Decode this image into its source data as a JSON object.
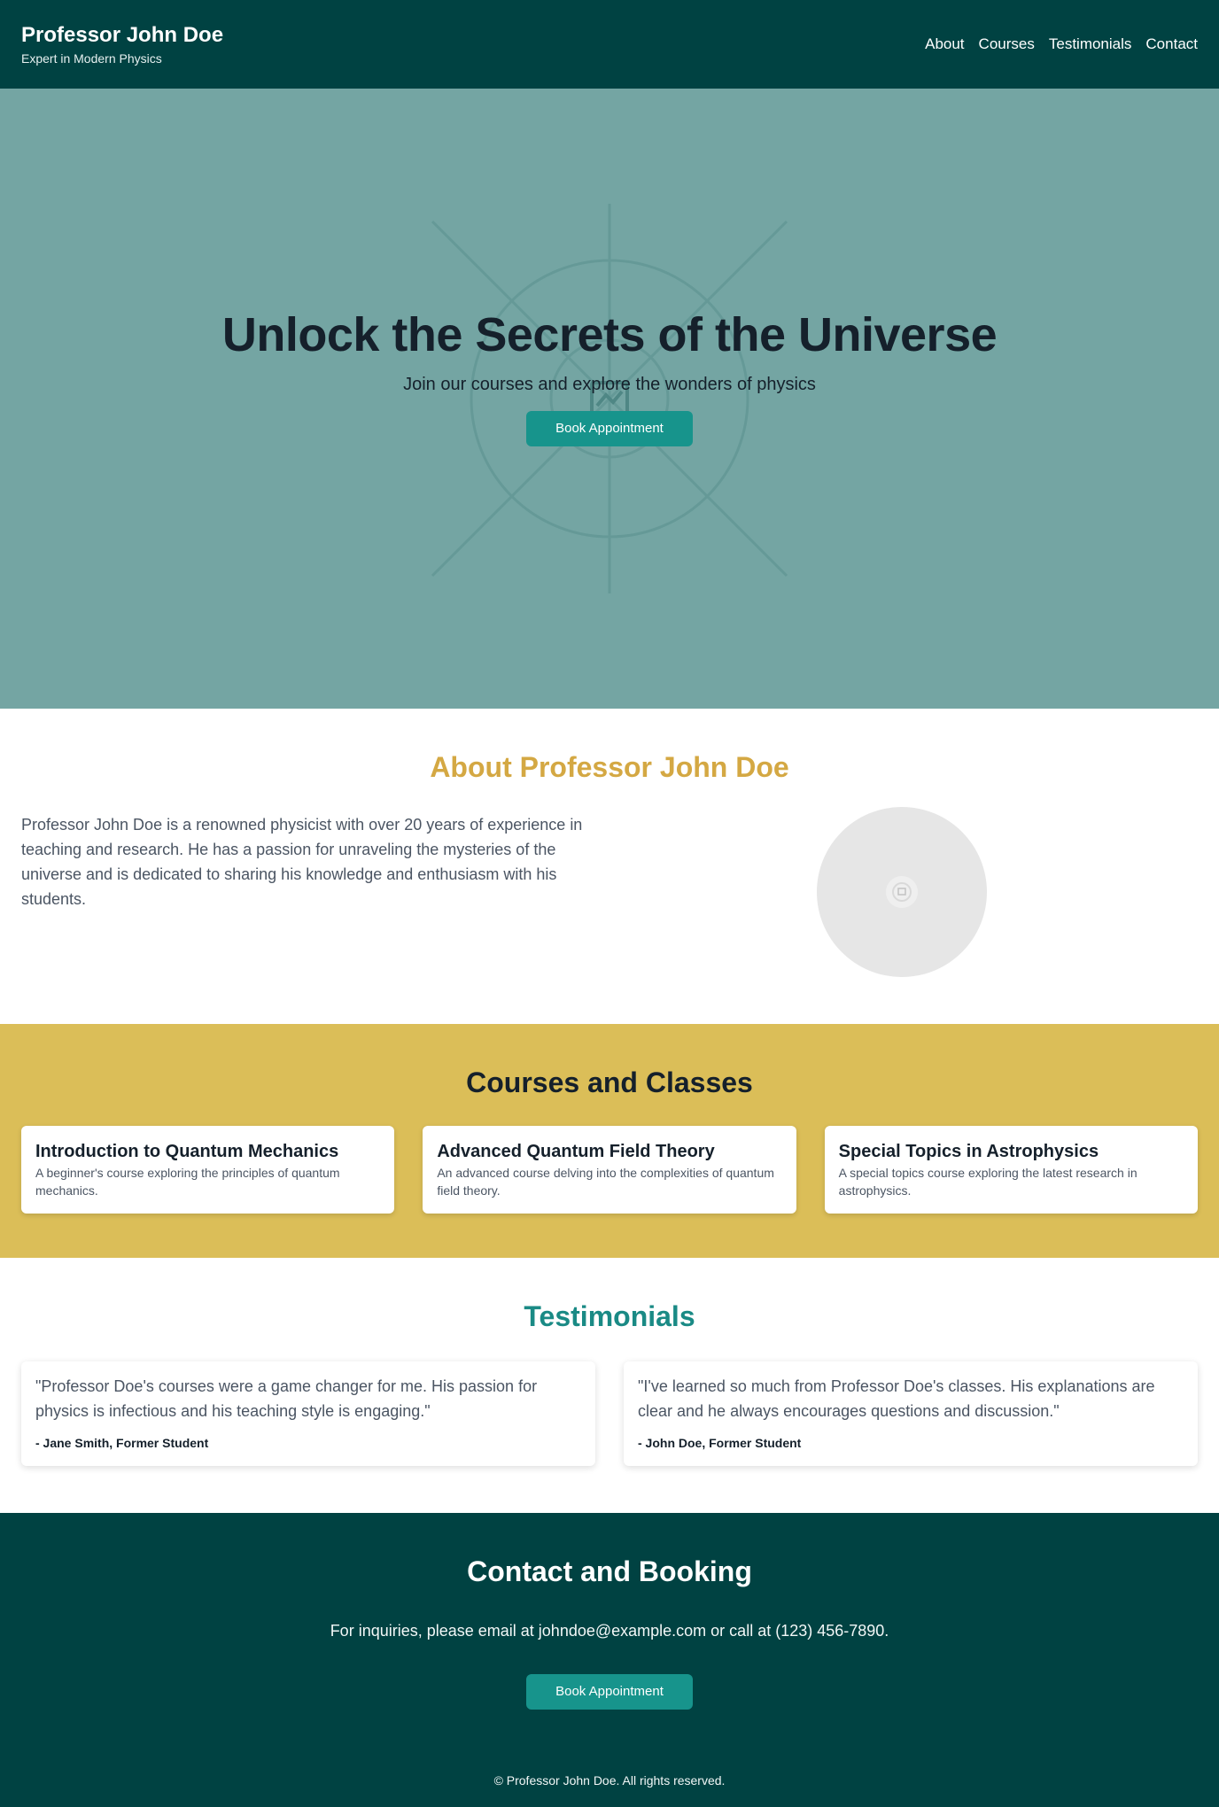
{
  "header": {
    "name": "Professor John Doe",
    "tagline": "Expert in Modern Physics",
    "nav": [
      "About",
      "Courses",
      "Testimonials",
      "Contact"
    ]
  },
  "hero": {
    "title": "Unlock the Secrets of the Universe",
    "subtitle": "Join our courses and explore the wonders of physics",
    "button": "Book Appointment",
    "background_icon": "image-placeholder-icon"
  },
  "about": {
    "title": "About Professor John Doe",
    "text": "Professor John Doe is a renowned physicist with over 20 years of experience in teaching and research. He has a passion for unraveling the mysteries of the universe and is dedicated to sharing his knowledge and enthusiasm with his students.",
    "photo_icon": "avatar-placeholder-icon"
  },
  "courses": {
    "title": "Courses and Classes",
    "items": [
      {
        "title": "Introduction to Quantum Mechanics",
        "description": "A beginner's course exploring the principles of quantum mechanics."
      },
      {
        "title": "Advanced Quantum Field Theory",
        "description": "An advanced course delving into the complexities of quantum field theory."
      },
      {
        "title": "Special Topics in Astrophysics",
        "description": "A special topics course exploring the latest research in astrophysics."
      }
    ]
  },
  "testimonials": {
    "title": "Testimonials",
    "items": [
      {
        "quote": "\"Professor Doe's courses were a game changer for me. His passion for physics is infectious and his teaching style is engaging.\"",
        "author": "- Jane Smith, Former Student"
      },
      {
        "quote": "\"I've learned so much from Professor Doe's classes. His explanations are clear and he always encourages questions and discussion.\"",
        "author": "- John Doe, Former Student"
      }
    ]
  },
  "contact": {
    "title": "Contact and Booking",
    "text": "For inquiries, please email at johndoe@example.com or call at (123) 456-7890.",
    "button": "Book Appointment",
    "copyright": "© Professor John Doe. All rights reserved."
  },
  "colors": {
    "header_bg": "#004242",
    "hero_bg": "#74a5a3",
    "accent_gold": "#d4a843",
    "courses_bg": "#dbbe58",
    "button": "#17948c",
    "testimonials_title": "#1a8a85"
  }
}
